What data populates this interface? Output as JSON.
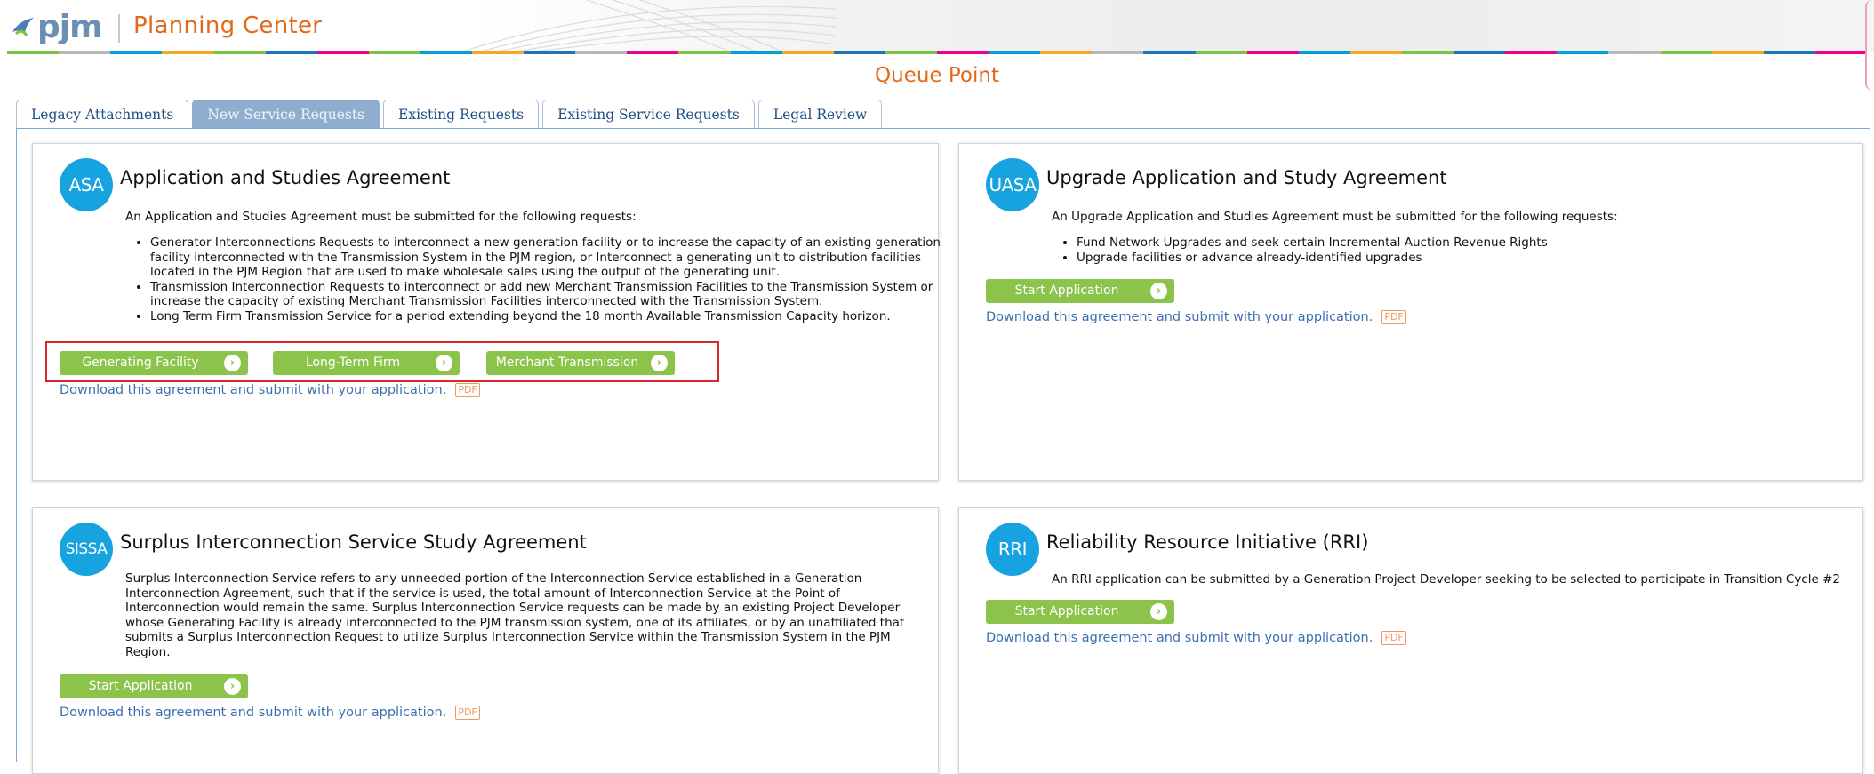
{
  "header": {
    "logo_text": "pjm",
    "app_title": "Planning Center",
    "strip_colors": [
      "#7dc242",
      "#b7b7b7",
      "#00a0dc",
      "#f7a823",
      "#7dc242",
      "#1b75bc",
      "#ec008c",
      "#7dc242",
      "#00a0dc",
      "#f7a823",
      "#1b75bc",
      "#b7b7b7",
      "#ec008c",
      "#7dc242",
      "#00a0dc",
      "#f7a823",
      "#1b75bc",
      "#7dc242",
      "#ec008c",
      "#00a0dc",
      "#f7a823",
      "#b7b7b7",
      "#1b75bc",
      "#7dc242",
      "#ec008c",
      "#00a0dc",
      "#f7a823",
      "#7dc242",
      "#1b75bc",
      "#ec008c",
      "#00a0dc",
      "#b7b7b7",
      "#7dc242",
      "#f7a823",
      "#1b75bc",
      "#ec008c"
    ]
  },
  "page": {
    "title": "Queue Point"
  },
  "tabs": [
    {
      "label": "Legacy Attachments",
      "active": false
    },
    {
      "label": "New Service Requests",
      "active": true
    },
    {
      "label": "Existing Requests",
      "active": false
    },
    {
      "label": "Existing Service Requests",
      "active": false
    },
    {
      "label": "Legal Review",
      "active": false
    }
  ],
  "cards": {
    "asa": {
      "badge": "ASA",
      "title": "Application and Studies Agreement",
      "intro": "An Application and Studies Agreement must be submitted for the following requests:",
      "bullets": [
        "Generator Interconnections Requests to interconnect a new generation facility or to increase the capacity of an existing generation facility interconnected with the Transmission System in the PJM region, or Interconnect a generating unit to distribution facilities located in the PJM Region that are used to make wholesale sales using the output of the generating unit.",
        "Transmission Interconnection Requests to interconnect or add new Merchant Transmission Facilities to the Transmission System or increase the capacity of existing Merchant Transmission Facilities interconnected with the Transmission System.",
        "Long Term Firm Transmission Service for a period extending beyond the 18 month Available Transmission Capacity horizon."
      ],
      "buttons": [
        "Generating Facility",
        "Long-Term Firm",
        "Merchant Transmission"
      ],
      "download": "Download this agreement and submit with your application.",
      "pdf": "PDF"
    },
    "uasa": {
      "badge": "UASA",
      "title": "Upgrade Application and Study Agreement",
      "intro": "An Upgrade Application and Studies Agreement must be submitted for the following requests:",
      "bullets": [
        "Fund Network Upgrades and seek certain Incremental Auction Revenue Rights",
        "Upgrade facilities or advance already-identified upgrades"
      ],
      "button": "Start Application",
      "download": "Download this agreement and submit with your application.",
      "pdf": "PDF"
    },
    "sissa": {
      "badge": "SISSA",
      "title": "Surplus Interconnection Service Study Agreement",
      "text": "Surplus Interconnection Service refers to any unneeded portion of the Interconnection Service established in a Generation Interconnection Agreement, such that if the service is used, the total amount of Interconnection Service at the Point of Interconnection would remain the same. Surplus Interconnection Service requests can be made by an existing Project Developer whose Generating Facility is already interconnected to the PJM transmission system, one of its affiliates, or by an unaffiliated that submits a Surplus Interconnection Request to utilize Surplus Interconnection Service within the Transmission System in the PJM Region.",
      "button": "Start Application",
      "download": "Download this agreement and submit with your application.",
      "pdf": "PDF"
    },
    "rri": {
      "badge": "RRI",
      "title": "Reliability Resource Initiative (RRI)",
      "text": "An RRI application can be submitted by a Generation Project Developer seeking to be selected to participate in Transition Cycle #2",
      "button": "Start Application",
      "download": "Download this agreement and submit with your application.",
      "pdf": "PDF"
    }
  }
}
